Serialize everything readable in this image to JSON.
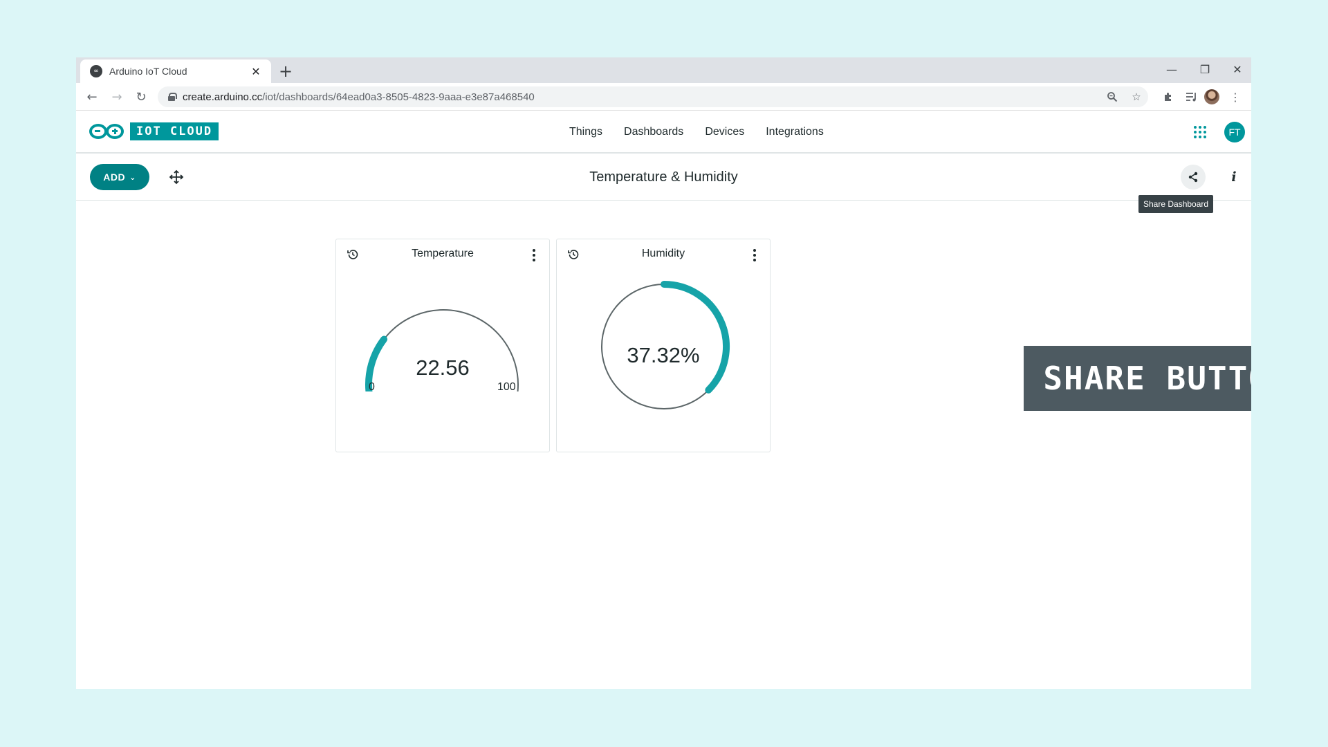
{
  "browser": {
    "tab_title": "Arduino IoT Cloud",
    "tab_close_icon": "close-icon",
    "new_tab_symbol": "+",
    "url_host": "create.arduino.cc",
    "url_path": "/iot/dashboards/64ead0a3-8505-4823-9aaa-e3e87a468540"
  },
  "app": {
    "logo_text": "IOT CLOUD",
    "brand_color": "#00979c",
    "nav": [
      "Things",
      "Dashboards",
      "Devices",
      "Integrations"
    ],
    "user_initials": "FT"
  },
  "dashboard": {
    "add_label": "ADD",
    "title": "Temperature & Humidity",
    "share_tooltip": "Share Dashboard",
    "info_label": "i"
  },
  "widgets": [
    {
      "title": "Temperature",
      "type": "gauge",
      "value": "22.56",
      "numeric_value": 22.56,
      "min": "0",
      "max": "100"
    },
    {
      "title": "Humidity",
      "type": "percentage",
      "value": "37.32%",
      "numeric_value": 37.32
    }
  ],
  "annotation": {
    "text": "SHARE BUTTON"
  }
}
